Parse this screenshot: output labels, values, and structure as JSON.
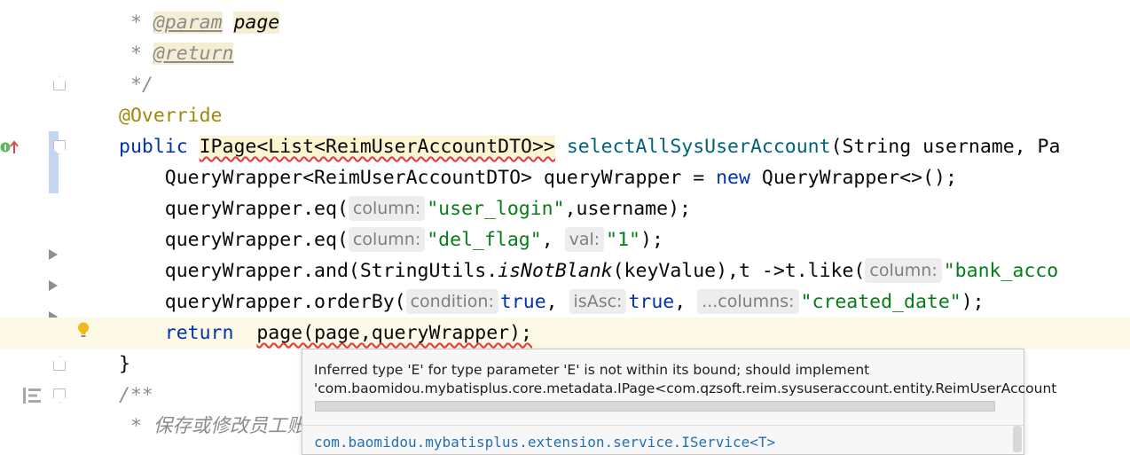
{
  "editor": {
    "lines": [
      {
        "id": "l1",
        "tokens": [
          {
            "t": " * ",
            "c": "cm"
          },
          {
            "t": "@param",
            "c": "tag tagbg"
          },
          {
            "t": " ",
            "c": "cm"
          },
          {
            "t": "page",
            "c": "tagbg ital"
          }
        ]
      },
      {
        "id": "l2",
        "tokens": [
          {
            "t": " * ",
            "c": "cm"
          },
          {
            "t": "@return",
            "c": "tag tagbg"
          }
        ]
      },
      {
        "id": "l3",
        "tokens": [
          {
            "t": " */",
            "c": "cm"
          }
        ]
      },
      {
        "id": "l4",
        "tokens": [
          {
            "t": "@Override",
            "c": "ann"
          }
        ]
      },
      {
        "id": "l5",
        "tokens": [
          {
            "t": "public ",
            "c": "kw"
          },
          {
            "t": "IPage<List<ReimUserAccountDTO>>",
            "c": "err"
          },
          {
            "t": " ",
            "c": ""
          },
          {
            "t": "selectAllSysUserAccount",
            "c": "fn"
          },
          {
            "t": "(String username, Pa",
            "c": ""
          }
        ]
      },
      {
        "id": "l6",
        "tokens": [
          {
            "t": "    QueryWrapper<ReimUserAccountDTO> queryWrapper = ",
            "c": ""
          },
          {
            "t": "new ",
            "c": "kw"
          },
          {
            "t": "QueryWrapper<>();",
            "c": ""
          }
        ]
      },
      {
        "id": "l7",
        "tokens": [
          {
            "t": "    queryWrapper.eq(",
            "c": ""
          },
          {
            "h": "column:"
          },
          {
            "t": "\"user_login\"",
            "c": "str"
          },
          {
            "t": ",username);",
            "c": ""
          }
        ]
      },
      {
        "id": "l8",
        "tokens": [
          {
            "t": "    queryWrapper.eq(",
            "c": ""
          },
          {
            "h": "column:"
          },
          {
            "t": "\"del_flag\"",
            "c": "str"
          },
          {
            "t": ", ",
            "c": ""
          },
          {
            "h": "val:"
          },
          {
            "t": "\"1\"",
            "c": "str"
          },
          {
            "t": ");",
            "c": ""
          }
        ]
      },
      {
        "id": "l9",
        "tokens": [
          {
            "t": "    queryWrapper.and(StringUtils.",
            "c": ""
          },
          {
            "t": "isNotBlank",
            "c": "ital"
          },
          {
            "t": "(keyValue),t ->t.like(",
            "c": ""
          },
          {
            "h": "column:"
          },
          {
            "t": "\"bank_acco",
            "c": "str"
          }
        ]
      },
      {
        "id": "l10",
        "tokens": [
          {
            "t": "    queryWrapper.orderBy(",
            "c": ""
          },
          {
            "h": "condition:"
          },
          {
            "t": "true",
            "c": "kw"
          },
          {
            "t": ", ",
            "c": ""
          },
          {
            "h": "isAsc:"
          },
          {
            "t": "true",
            "c": "kw"
          },
          {
            "t": ", ",
            "c": ""
          },
          {
            "h": "...columns:"
          },
          {
            "t": "\"created_date\"",
            "c": "str"
          },
          {
            "t": ");",
            "c": ""
          }
        ]
      },
      {
        "id": "l11",
        "tokens": [
          {
            "t": "    ",
            "c": ""
          },
          {
            "t": "return",
            "c": "kw"
          },
          {
            "t": "  ",
            "c": ""
          },
          {
            "t": "page(page,queryWrapper);",
            "c": "errline"
          }
        ]
      },
      {
        "id": "l12",
        "tokens": [
          {
            "t": "}",
            "c": ""
          }
        ]
      },
      {
        "id": "l13",
        "tokens": [
          {
            "t": "/**",
            "c": "cm"
          }
        ]
      },
      {
        "id": "l14",
        "tokens": [
          {
            "t": " * 保存或修改员工账",
            "c": "cm"
          }
        ]
      }
    ]
  },
  "tooltip": {
    "line1": "Inferred type 'E' for type parameter 'E' is not within its bound; should implement",
    "line2": "'com.baomidou.mybatisplus.core.metadata.IPage<com.qzsoft.reim.sysuseraccount.entity.ReimUserAccount",
    "link": "com.baomidou.mybatisplus.extension.service.IService<T>"
  }
}
